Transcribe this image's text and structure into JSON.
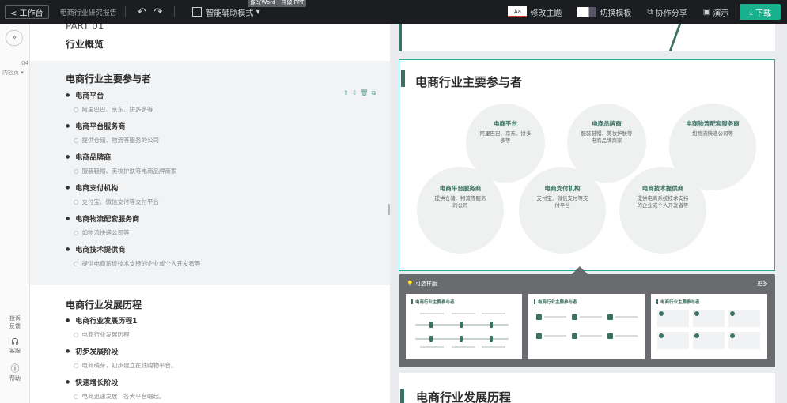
{
  "topbar": {
    "workbench": "< 工作台",
    "doc_title": "电商行业研究报告",
    "undo": "↶",
    "redo": "↷",
    "assist_mode": "智能辅助模式",
    "assist_tag": "像写Word一样做 PPT",
    "theme_chip": "Aa",
    "theme_label": "修改主题",
    "switch_template": "切换模板",
    "collab_share": "协作分享",
    "present": "演示",
    "download": "下载"
  },
  "left": {
    "collapse": "»",
    "page_number": "04",
    "page_label": "内容页 ▾",
    "feedback": "投诉反馈",
    "service": "客服",
    "help": "帮助"
  },
  "outline": {
    "part_label": "PART 01",
    "overview_title": "行业概览",
    "section1": {
      "title": "电商行业主要参与者",
      "items": [
        {
          "label": "电商平台",
          "sub": "阿里巴巴、京东、拼多多等"
        },
        {
          "label": "电商平台服务商",
          "sub": "提供仓储、物流等服务的公司"
        },
        {
          "label": "电商品牌商",
          "sub": "服装鞋帽、美妆护肤等电商品牌商家"
        },
        {
          "label": "电商支付机构",
          "sub": "支付宝、微信支付等支付平台"
        },
        {
          "label": "电商物流配套服务商",
          "sub": "如物流快递公司等"
        },
        {
          "label": "电商技术提供商",
          "sub": "提供电商系统技术支持的企业或个人开发者等"
        }
      ]
    },
    "section2": {
      "title": "电商行业发展历程",
      "items": [
        {
          "label": "电商行业发展历程1",
          "sub": "电商行业发展历程"
        },
        {
          "label": "初步发展阶段",
          "sub": "电商萌芽，初步建立在线购物平台。"
        },
        {
          "label": "快速增长阶段",
          "sub": "电商迅速发展，各大平台崛起。"
        }
      ]
    }
  },
  "slide": {
    "title": "电商行业主要参与者",
    "circles": [
      {
        "title": "电商平台",
        "desc": "阿里巴巴、京东、拼多多等"
      },
      {
        "title": "电商品牌商",
        "desc": "服装鞋帽、美妆护肤等电商品牌商家"
      },
      {
        "title": "电商物流配套服务商",
        "desc": "如物流快递公司等"
      },
      {
        "title": "电商平台服务商",
        "desc": "提供仓储、物流等服务的公司"
      },
      {
        "title": "电商支付机构",
        "desc": "支付宝、微信支付等支付平台"
      },
      {
        "title": "电商技术提供商",
        "desc": "提供电商系统技术支持的企业或个人开发者等"
      }
    ]
  },
  "templates": {
    "title": "可选样版",
    "more": "更多",
    "thumb_titles": [
      "电商行业主要参与者",
      "电商行业主要参与者",
      "电商行业主要参与者"
    ]
  },
  "next_slide": {
    "title": "电商行业发展历程"
  },
  "colors": {
    "accent": "#3c7263",
    "download": "#19b08d",
    "selection": "#27b098"
  }
}
